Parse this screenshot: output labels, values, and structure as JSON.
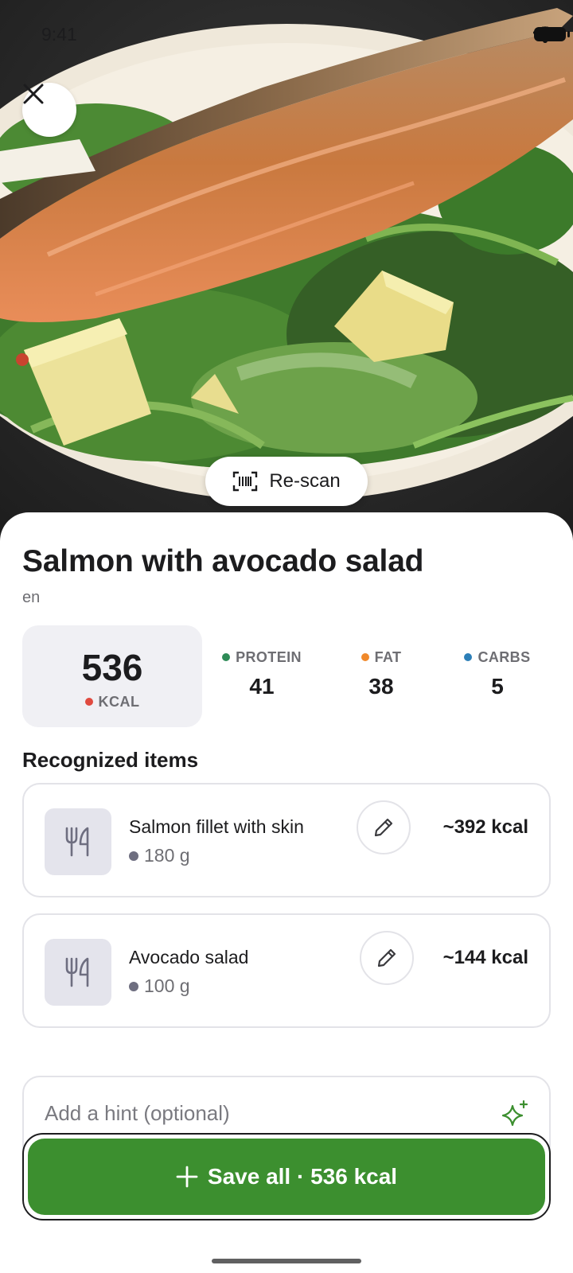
{
  "status_bar": {
    "time": "9:41"
  },
  "hero": {
    "rescan_label": "Re-scan"
  },
  "dish": {
    "title": "Salmon with avocado salad",
    "language": "en"
  },
  "nutrition": {
    "kcal_value": "536",
    "kcal_label": "KCAL",
    "protein": {
      "label": "PROTEIN",
      "value": "41",
      "color": "#2e8b57"
    },
    "fat": {
      "label": "FAT",
      "value": "38",
      "color": "#f0892b"
    },
    "carbs": {
      "label": "CARBS",
      "value": "5",
      "color": "#2d7fb8"
    },
    "kcal_dot_color": "#e04a3f"
  },
  "items_section": {
    "title": "Recognized items",
    "items": [
      {
        "name": "Salmon fillet with skin",
        "weight": "180 g",
        "kcal": "~392 kcal"
      },
      {
        "name": "Avocado salad",
        "weight": "100 g",
        "kcal": "~144 kcal"
      }
    ]
  },
  "hint": {
    "placeholder": "Add a hint (optional)"
  },
  "save": {
    "label": "Save all · 536 kcal"
  },
  "colors": {
    "accent_green": "#3c8f2f",
    "card_bg": "#f0f0f4"
  },
  "icons": [
    "close-icon",
    "barcode-scan-icon",
    "cutlery-icon",
    "pencil-icon",
    "sparkle-icon",
    "plus-icon",
    "wifi-icon",
    "signal-icon",
    "battery-icon"
  ]
}
